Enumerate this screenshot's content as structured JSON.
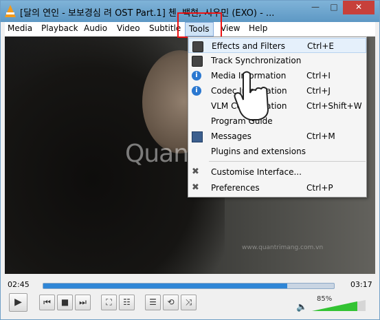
{
  "window": {
    "title": "[달의 연인 - 보보경심 려 OST Part.1] 첸, 백현, 시우민 (EXO) - ...",
    "min_label": "—",
    "max_label": "□",
    "close_label": "✕"
  },
  "menu": {
    "items": [
      "Media",
      "Playback",
      "Audio",
      "Video",
      "Subtitle",
      "Tools",
      "View",
      "Help"
    ]
  },
  "tools_menu": {
    "items": [
      {
        "label": "Effects and Filters",
        "shortcut": "Ctrl+E",
        "icon": "equalizer-icon"
      },
      {
        "label": "Track Synchronization",
        "shortcut": "",
        "icon": "equalizer-icon"
      },
      {
        "label": "Media Information",
        "shortcut": "Ctrl+I",
        "icon": "info-icon"
      },
      {
        "label": "Codec Information",
        "shortcut": "Ctrl+J",
        "icon": "info-icon"
      },
      {
        "label": "VLM Configuration",
        "shortcut": "Ctrl+Shift+W",
        "icon": ""
      },
      {
        "label": "Program Guide",
        "shortcut": "",
        "icon": ""
      },
      {
        "label": "Messages",
        "shortcut": "Ctrl+M",
        "icon": "messages-icon"
      },
      {
        "label": "Plugins and extensions",
        "shortcut": "",
        "icon": ""
      },
      {
        "label": "Customise Interface...",
        "shortcut": "",
        "icon": "tools-icon"
      },
      {
        "label": "Preferences",
        "shortcut": "Ctrl+P",
        "icon": "tools-icon"
      }
    ]
  },
  "video": {
    "watermark": "Quantrimang",
    "watermark_sub": "www.quantrimang.com.vn"
  },
  "player": {
    "elapsed": "02:45",
    "total": "03:17",
    "progress": 0.84,
    "volume_percent": "85%",
    "volume": 0.85
  },
  "accent": "#2f86d6"
}
